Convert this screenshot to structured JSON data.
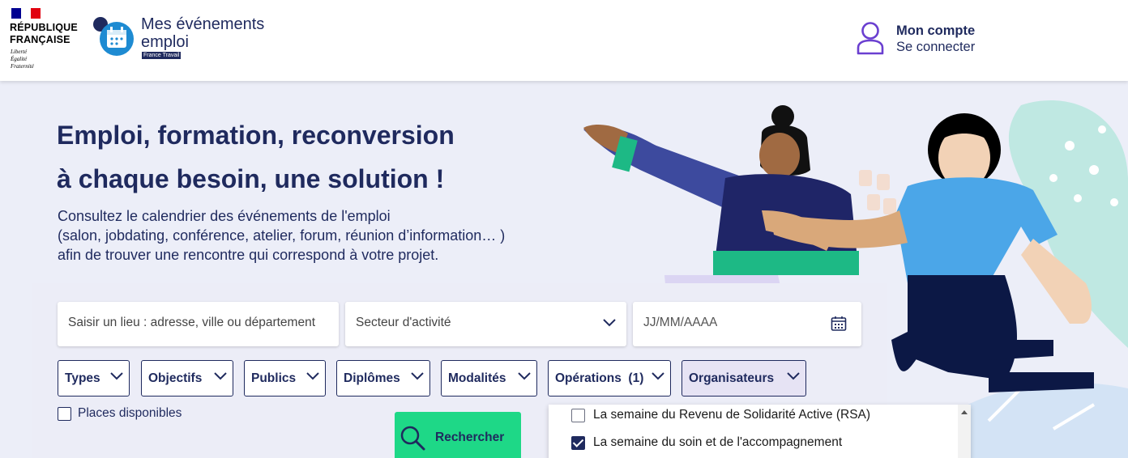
{
  "header": {
    "gov_name_line1": "RÉPUBLIQUE",
    "gov_name_line2": "FRANÇAISE",
    "motto_line1": "Liberté",
    "motto_line2": "Égalité",
    "motto_line3": "Fraternité",
    "brand_title_line1": "Mes événements",
    "brand_title_line2": "emploi",
    "brand_subtitle": "France Travail",
    "account_title": "Mon compte",
    "account_subtitle": "Se connecter"
  },
  "hero": {
    "title_line1": "Emploi, formation, reconversion",
    "title_line2": "à chaque besoin, une solution !",
    "desc_line1": "Consultez le calendrier des événements de l'emploi",
    "desc_line2": "(salon, jobdating, conférence, atelier, forum, réunion d’information… )",
    "desc_line3": "afin de trouver une rencontre qui correspond à votre projet."
  },
  "search": {
    "location_placeholder": "Saisir un lieu : adresse, ville ou département",
    "sector_placeholder": "Secteur d'activité",
    "date_placeholder": "JJ/MM/AAAA",
    "filters": [
      {
        "label": "Types"
      },
      {
        "label": "Objectifs"
      },
      {
        "label": "Publics"
      },
      {
        "label": "Diplômes"
      },
      {
        "label": "Modalités"
      },
      {
        "label": "Opérations  (1)"
      },
      {
        "label": "Organisateurs"
      }
    ],
    "places_label": "Places disponibles",
    "search_button": "Rechercher"
  },
  "operations_dropdown": {
    "options": [
      {
        "label": "La semaine du Revenu de Solidarité Active (RSA)",
        "checked": false
      },
      {
        "label": "La semaine du soin et de l'accompagnement",
        "checked": true
      }
    ]
  },
  "colors": {
    "navy": "#1f2a5e",
    "green": "#1ed887",
    "flag_blue": "#000091",
    "flag_red": "#e1000f",
    "account_icon": "#6a3fd0"
  }
}
